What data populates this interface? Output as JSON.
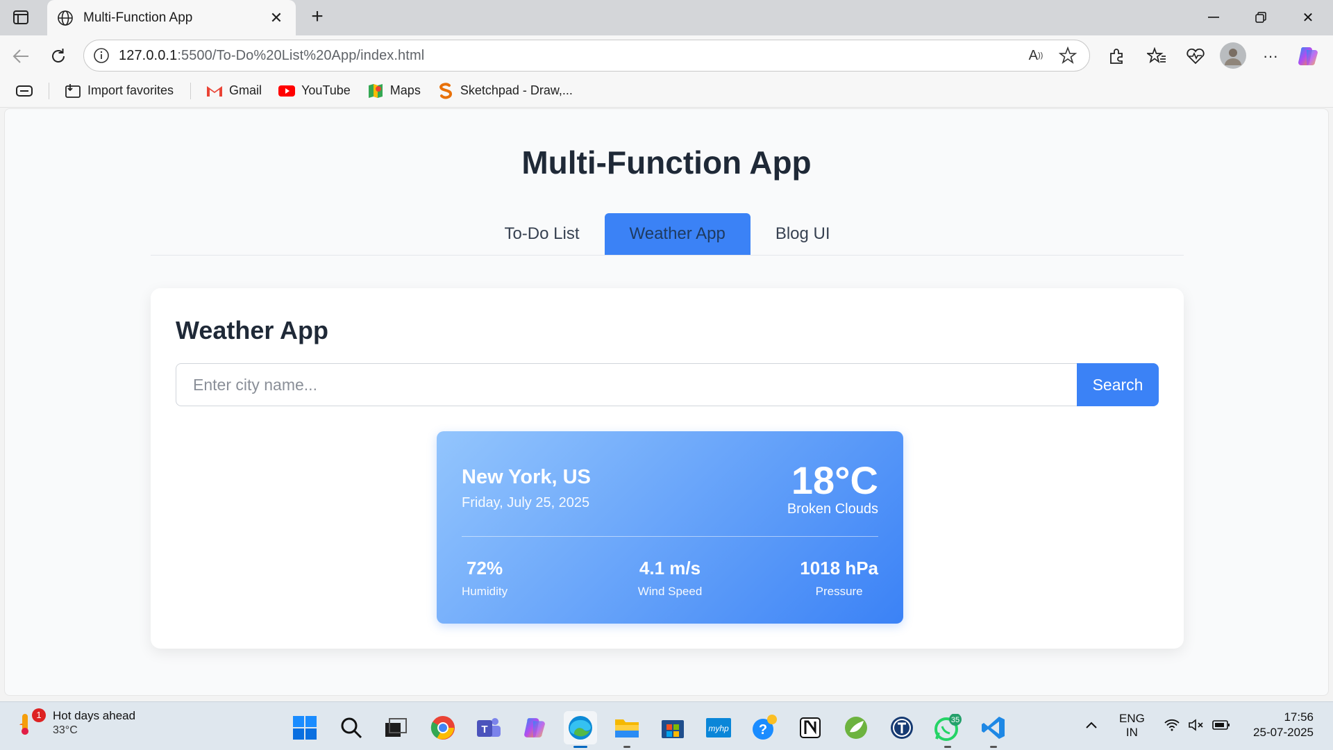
{
  "browser": {
    "tab_title": "Multi-Function App",
    "url_host": "127.0.0.1",
    "url_rest": ":5500/To-Do%20List%20App/index.html"
  },
  "favorites": [
    {
      "label": "Import favorites",
      "icon": "import-icon"
    },
    {
      "label": "Gmail",
      "icon": "gmail-icon"
    },
    {
      "label": "YouTube",
      "icon": "youtube-icon"
    },
    {
      "label": "Maps",
      "icon": "maps-icon"
    },
    {
      "label": "Sketchpad - Draw,...",
      "icon": "sketchpad-icon"
    }
  ],
  "page": {
    "title": "Multi-Function App",
    "tabs": [
      {
        "label": "To-Do List",
        "active": false
      },
      {
        "label": "Weather App",
        "active": true
      },
      {
        "label": "Blog UI",
        "active": false
      }
    ]
  },
  "weather_app": {
    "heading": "Weather App",
    "search_placeholder": "Enter city name...",
    "search_button": "Search",
    "result": {
      "city": "New York, US",
      "date": "Friday, July 25, 2025",
      "temperature": "18°C",
      "condition": "Broken Clouds",
      "humidity": {
        "value": "72%",
        "label": "Humidity"
      },
      "wind": {
        "value": "4.1 m/s",
        "label": "Wind Speed"
      },
      "pressure": {
        "value": "1018 hPa",
        "label": "Pressure"
      }
    }
  },
  "taskbar": {
    "weather_text": "Hot days ahead",
    "weather_temp": "33°C",
    "weather_badge": "1",
    "whatsapp_badge": "35",
    "lang_top": "ENG",
    "lang_bottom": "IN",
    "time": "17:56",
    "date": "25-07-2025"
  },
  "colors": {
    "accent": "#3b82f6",
    "weather_gradient_start": "#93c5fd",
    "weather_gradient_end": "#3b82f6"
  }
}
